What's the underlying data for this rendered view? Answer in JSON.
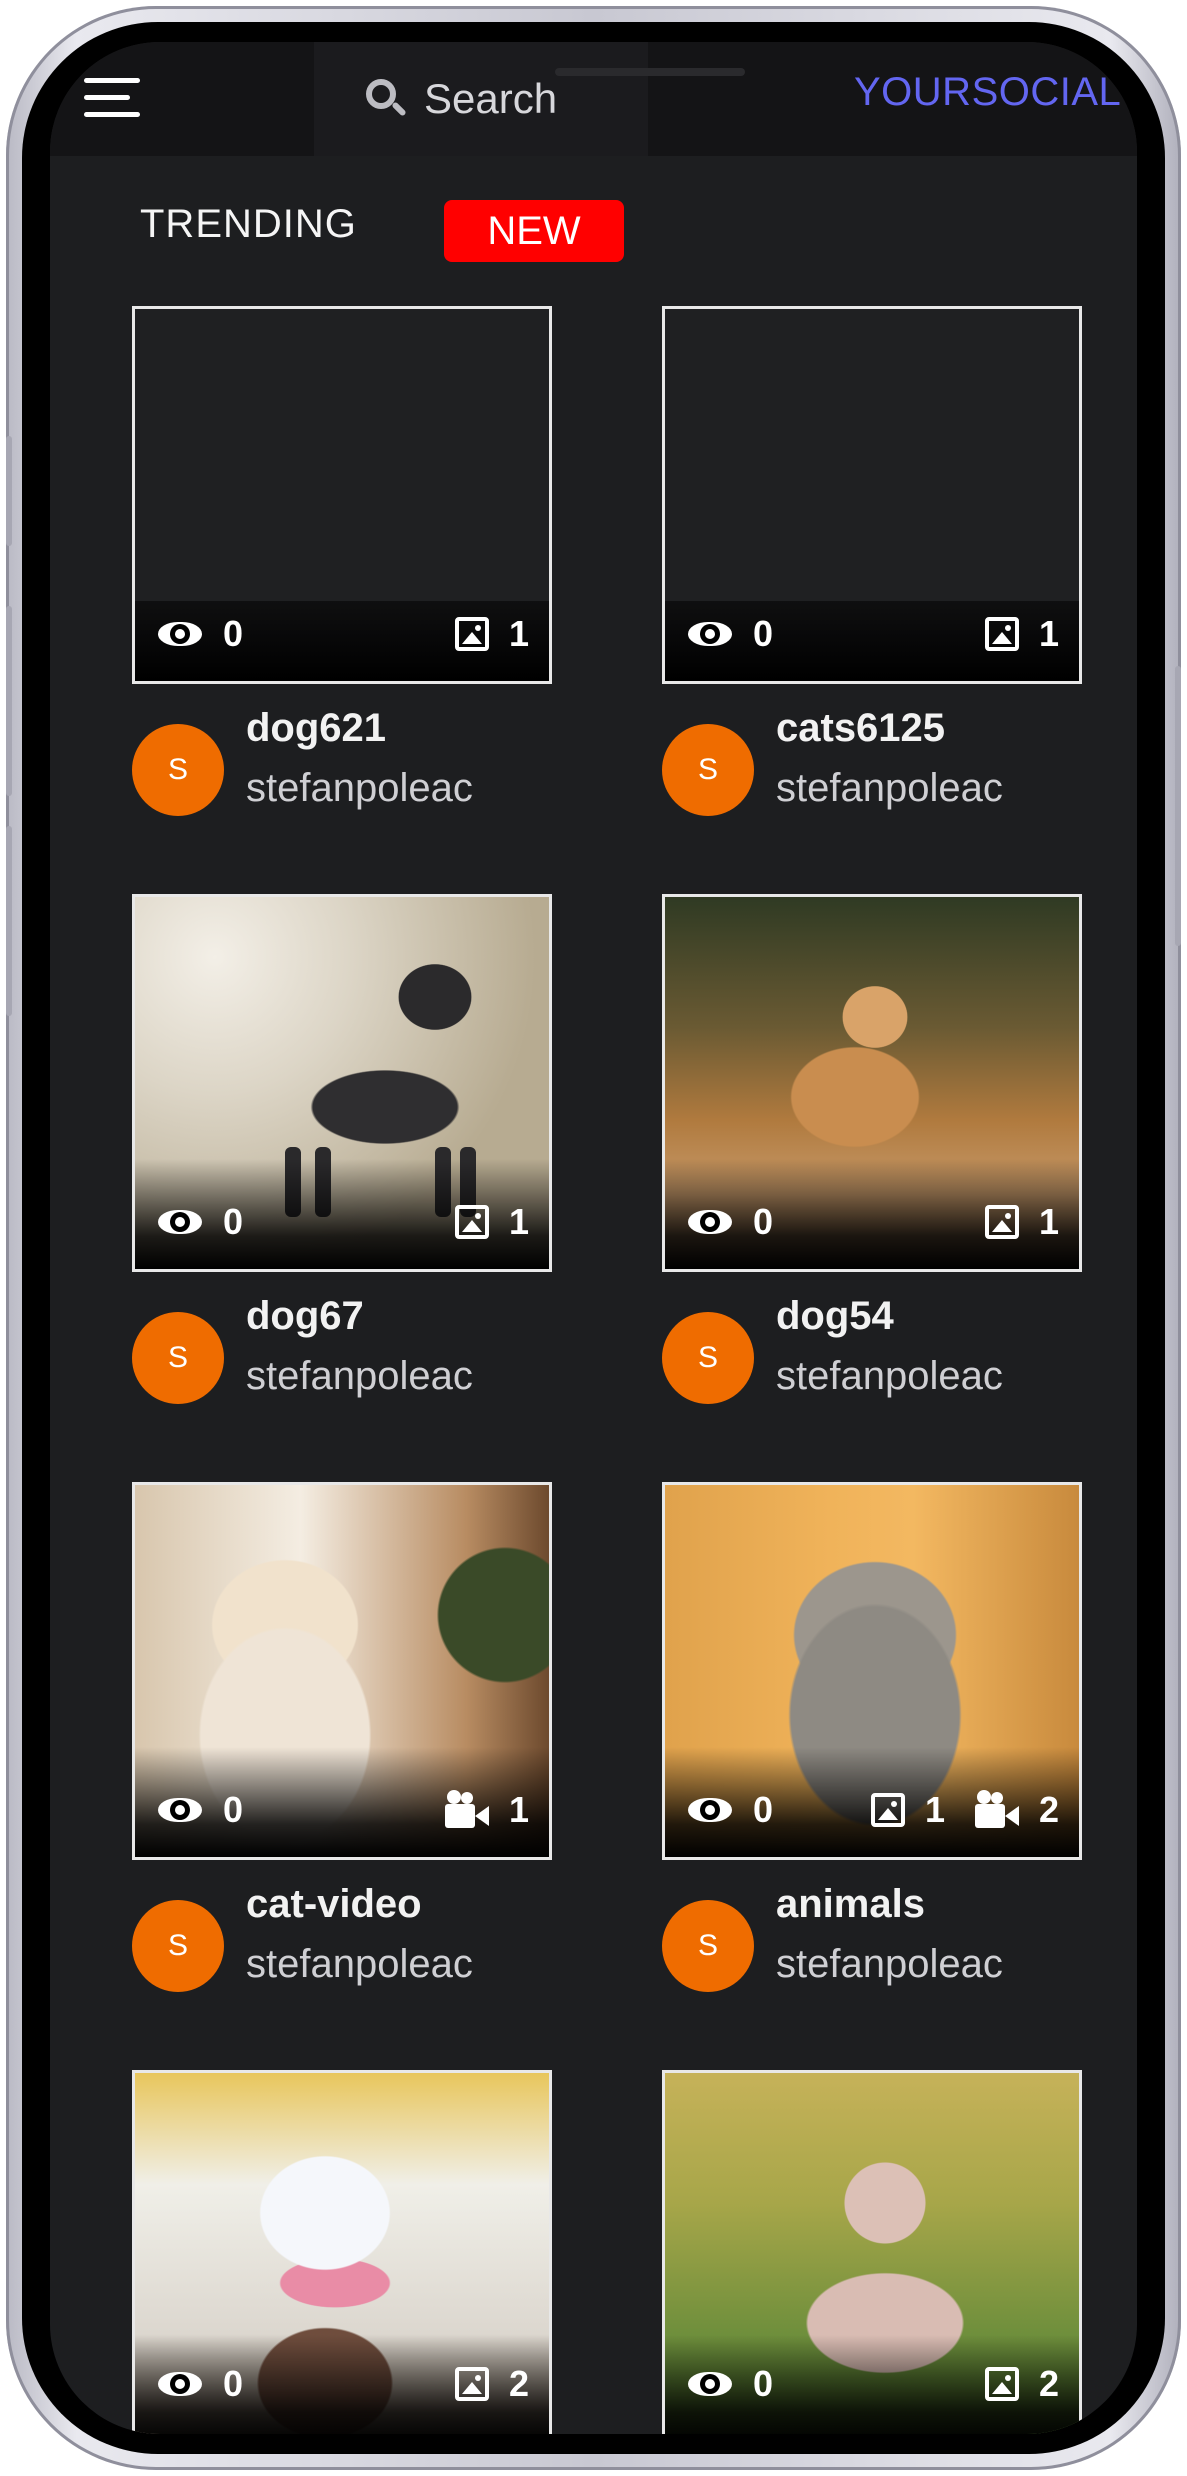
{
  "topbar": {
    "search_label": "Search",
    "brand": "YOURSOCIAL"
  },
  "tabs": {
    "trending": "TRENDING",
    "new": "NEW",
    "active": "NEW"
  },
  "posts": [
    {
      "title": "dog621",
      "author": "stefanpoleac",
      "avatar": "S",
      "views": "0",
      "images": "1",
      "videos": "",
      "thumbnail": "empty"
    },
    {
      "title": "cats6125",
      "author": "stefanpoleac",
      "avatar": "S",
      "views": "0",
      "images": "1",
      "videos": "",
      "thumbnail": "empty"
    },
    {
      "title": "dog67",
      "author": "stefanpoleac",
      "avatar": "S",
      "views": "0",
      "images": "1",
      "videos": "",
      "thumbnail": "dachshund"
    },
    {
      "title": "dog54",
      "author": "stefanpoleac",
      "avatar": "S",
      "views": "0",
      "images": "1",
      "videos": "",
      "thumbnail": "golden-retriever"
    },
    {
      "title": "cat-video",
      "author": "stefanpoleac",
      "avatar": "S",
      "views": "0",
      "images": "",
      "videos": "1",
      "thumbnail": "white-cat"
    },
    {
      "title": "animals",
      "author": "stefanpoleac",
      "avatar": "S",
      "views": "0",
      "images": "1",
      "videos": "2",
      "thumbnail": "tabby-cat"
    },
    {
      "title": "",
      "author": "",
      "avatar": "",
      "views": "0",
      "images": "2",
      "videos": "",
      "thumbnail": "kitten-flowers"
    },
    {
      "title": "",
      "author": "",
      "avatar": "",
      "views": "0",
      "images": "2",
      "videos": "",
      "thumbnail": "poodle"
    }
  ],
  "colors": {
    "background": "#1d1e20",
    "brand": "#6366f1",
    "new_tab": "#ff0000",
    "avatar": "#ef6c00"
  }
}
